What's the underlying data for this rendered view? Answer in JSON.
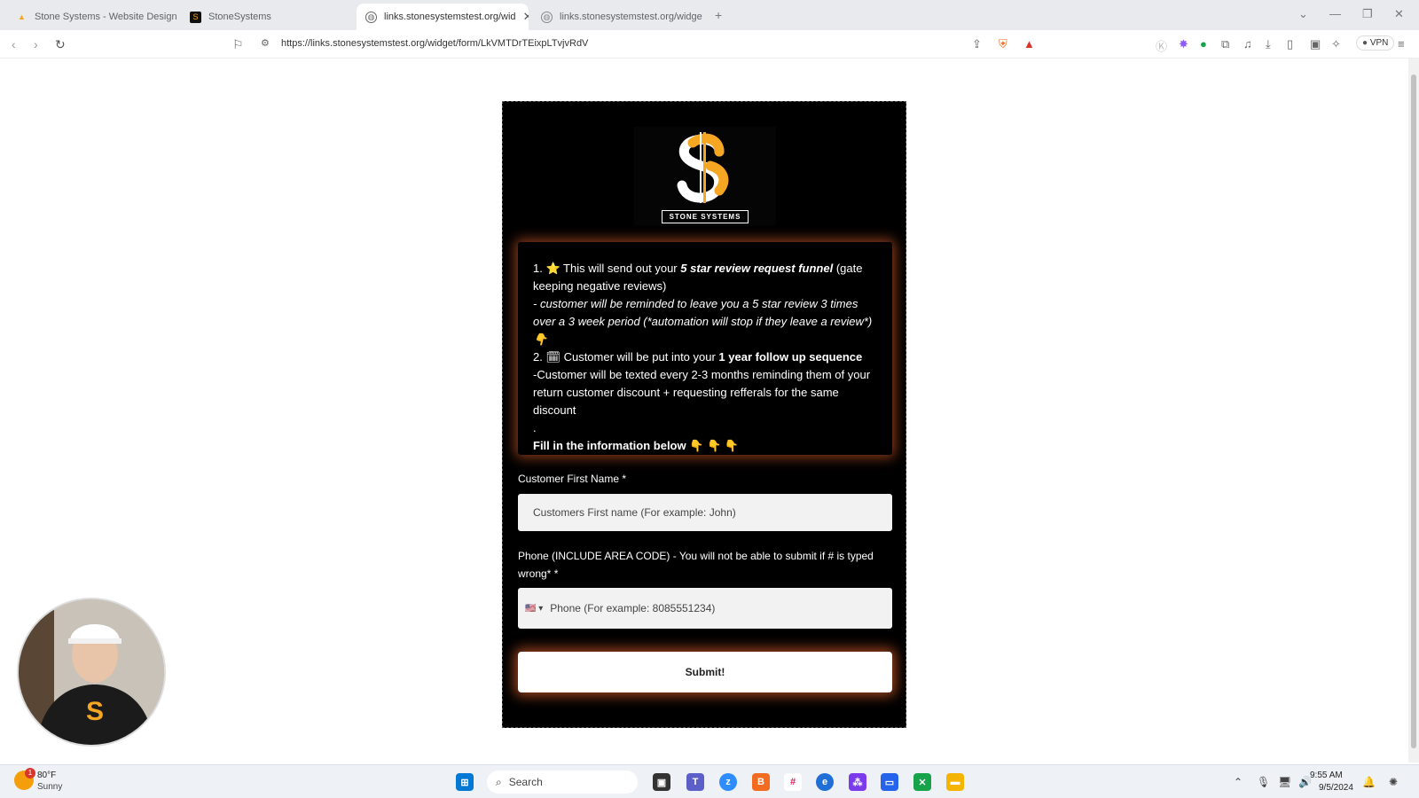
{
  "browser": {
    "tabs": [
      {
        "title": "Stone Systems - Website Design &",
        "active": false
      },
      {
        "title": "StoneSystems",
        "active": false
      },
      {
        "title": "links.stonesystemstest.org/wid",
        "active": true
      },
      {
        "title": "links.stonesystemstest.org/widget/f",
        "active": false
      }
    ],
    "new_tab": "+",
    "url": "https://links.stonesystemstest.org/widget/form/LkVMTDrTEixpLTvjvRdV",
    "vpn_label": "VPN"
  },
  "form": {
    "logo_text": "STONE SYSTEMS",
    "logo_mark": "S",
    "info": {
      "l1_prefix": "1. ⭐ This will send out your ",
      "l1_bold": "5 star review request funnel",
      "l1_suffix": " (gate keeping negative reviews)",
      "l2": "- customer will be reminded to leave you a 5 star review 3 times over a 3 week period (*automation will stop if they leave a review*) 👇",
      "l3_prefix": "2. 🗓 Customer will be put into your ",
      "l3_bold": "1 year follow up sequence",
      "l4": "-Customer will be texted every 2-3 months reminding them of your return customer discount + requesting refferals for the same discount",
      "l5": ".",
      "l6": "Fill in the information below 👇 👇 👇"
    },
    "first_name_label": "Customer First Name *",
    "first_name_placeholder": "Customers First name (For example: John)",
    "phone_label": "Phone (INCLUDE AREA CODE) - You will not be able to submit if # is typed wrong* *",
    "phone_flag": "🇺🇸 ▾",
    "phone_placeholder": "Phone (For example: 8085551234)",
    "submit_label": "Submit!"
  },
  "taskbar": {
    "weather_temp": "80°F",
    "weather_desc": "Sunny",
    "weather_badge": "1",
    "search_label": "Search",
    "time": "9:55 AM",
    "date": "9/5/2024"
  },
  "colors": {
    "accent_orange": "#f5a623",
    "form_bg": "#000000",
    "glow": "#ff6e32"
  }
}
